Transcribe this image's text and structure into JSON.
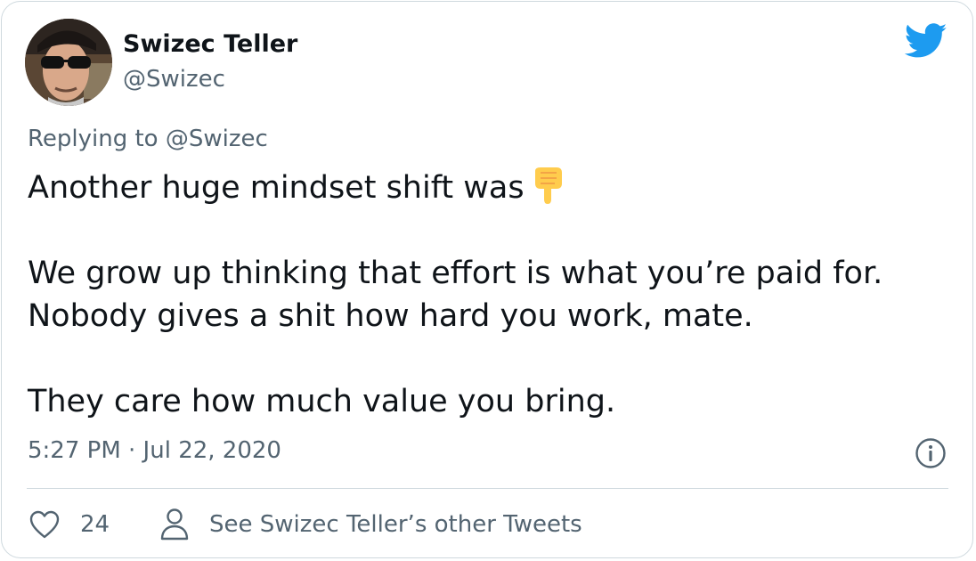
{
  "author": {
    "display_name": "Swizec Teller",
    "handle": "@Swizec"
  },
  "reply": {
    "text": "Replying to @Swizec"
  },
  "tweet": {
    "line1": "Another huge mindset shift was",
    "line2": "We grow up thinking that effort is what you’re paid for.",
    "line3": "Nobody gives a shit how hard you work, mate.",
    "line4": "They care how much value you bring."
  },
  "meta": {
    "timestamp": "5:27 PM · Jul 22, 2020"
  },
  "actions": {
    "like_count": "24",
    "other_tweets_label": "See Swizec Teller’s other Tweets"
  },
  "icons": {
    "brand": "twitter-bird-icon",
    "emoji": "pointing-down-hand-emoji",
    "info": "info-icon",
    "like": "heart-icon",
    "profile": "person-icon"
  },
  "colors": {
    "brand": "#1d9bf0",
    "text": "#0f1419",
    "secondary": "#536471",
    "border": "#cfd9de"
  }
}
